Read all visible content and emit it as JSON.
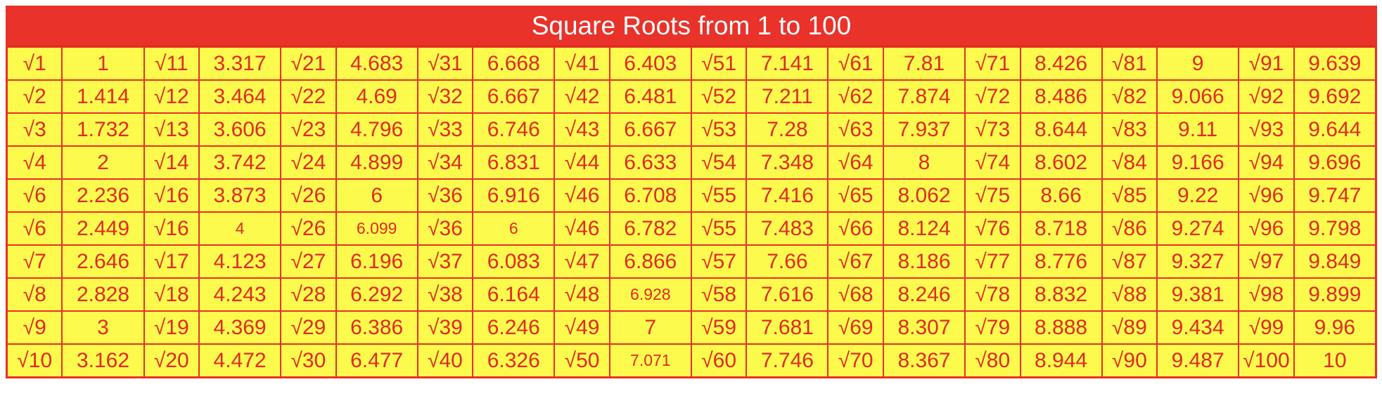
{
  "title": "Square Roots from 1 to 100",
  "rows": [
    [
      {
        "label": "√1",
        "value": "1"
      },
      {
        "label": "√11",
        "value": "3.317"
      },
      {
        "label": "√21",
        "value": "4.683"
      },
      {
        "label": "√31",
        "value": "6.668"
      },
      {
        "label": "√41",
        "value": "6.403"
      },
      {
        "label": "√51",
        "value": "7.141"
      },
      {
        "label": "√61",
        "value": "7.81"
      },
      {
        "label": "√71",
        "value": "8.426"
      },
      {
        "label": "√81",
        "value": "9"
      },
      {
        "label": "√91",
        "value": "9.639"
      }
    ],
    [
      {
        "label": "√2",
        "value": "1.414"
      },
      {
        "label": "√12",
        "value": "3.464"
      },
      {
        "label": "√22",
        "value": "4.69"
      },
      {
        "label": "√32",
        "value": "6.667"
      },
      {
        "label": "√42",
        "value": "6.481"
      },
      {
        "label": "√52",
        "value": "7.211"
      },
      {
        "label": "√62",
        "value": "7.874"
      },
      {
        "label": "√72",
        "value": "8.486"
      },
      {
        "label": "√82",
        "value": "9.066"
      },
      {
        "label": "√92",
        "value": "9.692"
      }
    ],
    [
      {
        "label": "√3",
        "value": "1.732"
      },
      {
        "label": "√13",
        "value": "3.606"
      },
      {
        "label": "√23",
        "value": "4.796"
      },
      {
        "label": "√33",
        "value": "6.746"
      },
      {
        "label": "√43",
        "value": "6.667"
      },
      {
        "label": "√53",
        "value": "7.28"
      },
      {
        "label": "√63",
        "value": "7.937"
      },
      {
        "label": "√73",
        "value": "8.644"
      },
      {
        "label": "√83",
        "value": "9.11"
      },
      {
        "label": "√93",
        "value": "9.644"
      }
    ],
    [
      {
        "label": "√4",
        "value": "2"
      },
      {
        "label": "√14",
        "value": "3.742"
      },
      {
        "label": "√24",
        "value": "4.899"
      },
      {
        "label": "√34",
        "value": "6.831"
      },
      {
        "label": "√44",
        "value": "6.633"
      },
      {
        "label": "√54",
        "value": "7.348"
      },
      {
        "label": "√64",
        "value": "8"
      },
      {
        "label": "√74",
        "value": "8.602"
      },
      {
        "label": "√84",
        "value": "9.166"
      },
      {
        "label": "√94",
        "value": "9.696"
      }
    ],
    [
      {
        "label": "√6",
        "value": "2.236"
      },
      {
        "label": "√16",
        "value": "3.873"
      },
      {
        "label": "√26",
        "value": "6"
      },
      {
        "label": "√36",
        "value": "6.916"
      },
      {
        "label": "√46",
        "value": "6.708"
      },
      {
        "label": "√55",
        "value": "7.416"
      },
      {
        "label": "√65",
        "value": "8.062"
      },
      {
        "label": "√75",
        "value": "8.66"
      },
      {
        "label": "√85",
        "value": "9.22"
      },
      {
        "label": "√96",
        "value": "9.747"
      }
    ],
    [
      {
        "label": "√6",
        "value": "2.449"
      },
      {
        "label": "√16",
        "value": "4",
        "small": true
      },
      {
        "label": "√26",
        "value": "6.099",
        "small": true
      },
      {
        "label": "√36",
        "value": "6",
        "small": true
      },
      {
        "label": "√46",
        "value": "6.782"
      },
      {
        "label": "√55",
        "value": "7.483"
      },
      {
        "label": "√66",
        "value": "8.124"
      },
      {
        "label": "√76",
        "value": "8.718"
      },
      {
        "label": "√86",
        "value": "9.274"
      },
      {
        "label": "√96",
        "value": "9.798"
      }
    ],
    [
      {
        "label": "√7",
        "value": "2.646"
      },
      {
        "label": "√17",
        "value": "4.123"
      },
      {
        "label": "√27",
        "value": "6.196"
      },
      {
        "label": "√37",
        "value": "6.083"
      },
      {
        "label": "√47",
        "value": "6.866"
      },
      {
        "label": "√57",
        "value": "7.66"
      },
      {
        "label": "√67",
        "value": "8.186"
      },
      {
        "label": "√77",
        "value": "8.776"
      },
      {
        "label": "√87",
        "value": "9.327"
      },
      {
        "label": "√97",
        "value": "9.849"
      }
    ],
    [
      {
        "label": "√8",
        "value": "2.828"
      },
      {
        "label": "√18",
        "value": "4.243"
      },
      {
        "label": "√28",
        "value": "6.292"
      },
      {
        "label": "√38",
        "value": "6.164"
      },
      {
        "label": "√48",
        "value": "6.928",
        "small": true
      },
      {
        "label": "√58",
        "value": "7.616"
      },
      {
        "label": "√68",
        "value": "8.246"
      },
      {
        "label": "√78",
        "value": "8.832"
      },
      {
        "label": "√88",
        "value": "9.381"
      },
      {
        "label": "√98",
        "value": "9.899"
      }
    ],
    [
      {
        "label": "√9",
        "value": "3"
      },
      {
        "label": "√19",
        "value": "4.369"
      },
      {
        "label": "√29",
        "value": "6.386"
      },
      {
        "label": "√39",
        "value": "6.246"
      },
      {
        "label": "√49",
        "value": "7"
      },
      {
        "label": "√59",
        "value": "7.681"
      },
      {
        "label": "√69",
        "value": "8.307"
      },
      {
        "label": "√79",
        "value": "8.888"
      },
      {
        "label": "√89",
        "value": "9.434"
      },
      {
        "label": "√99",
        "value": "9.96"
      }
    ],
    [
      {
        "label": "√10",
        "value": "3.162"
      },
      {
        "label": "√20",
        "value": "4.472"
      },
      {
        "label": "√30",
        "value": "6.477"
      },
      {
        "label": "√40",
        "value": "6.326"
      },
      {
        "label": "√50",
        "value": "7.071",
        "small": true
      },
      {
        "label": "√60",
        "value": "7.746"
      },
      {
        "label": "√70",
        "value": "8.367"
      },
      {
        "label": "√80",
        "value": "8.944"
      },
      {
        "label": "√90",
        "value": "9.487"
      },
      {
        "label": "√100",
        "value": "10"
      }
    ]
  ]
}
